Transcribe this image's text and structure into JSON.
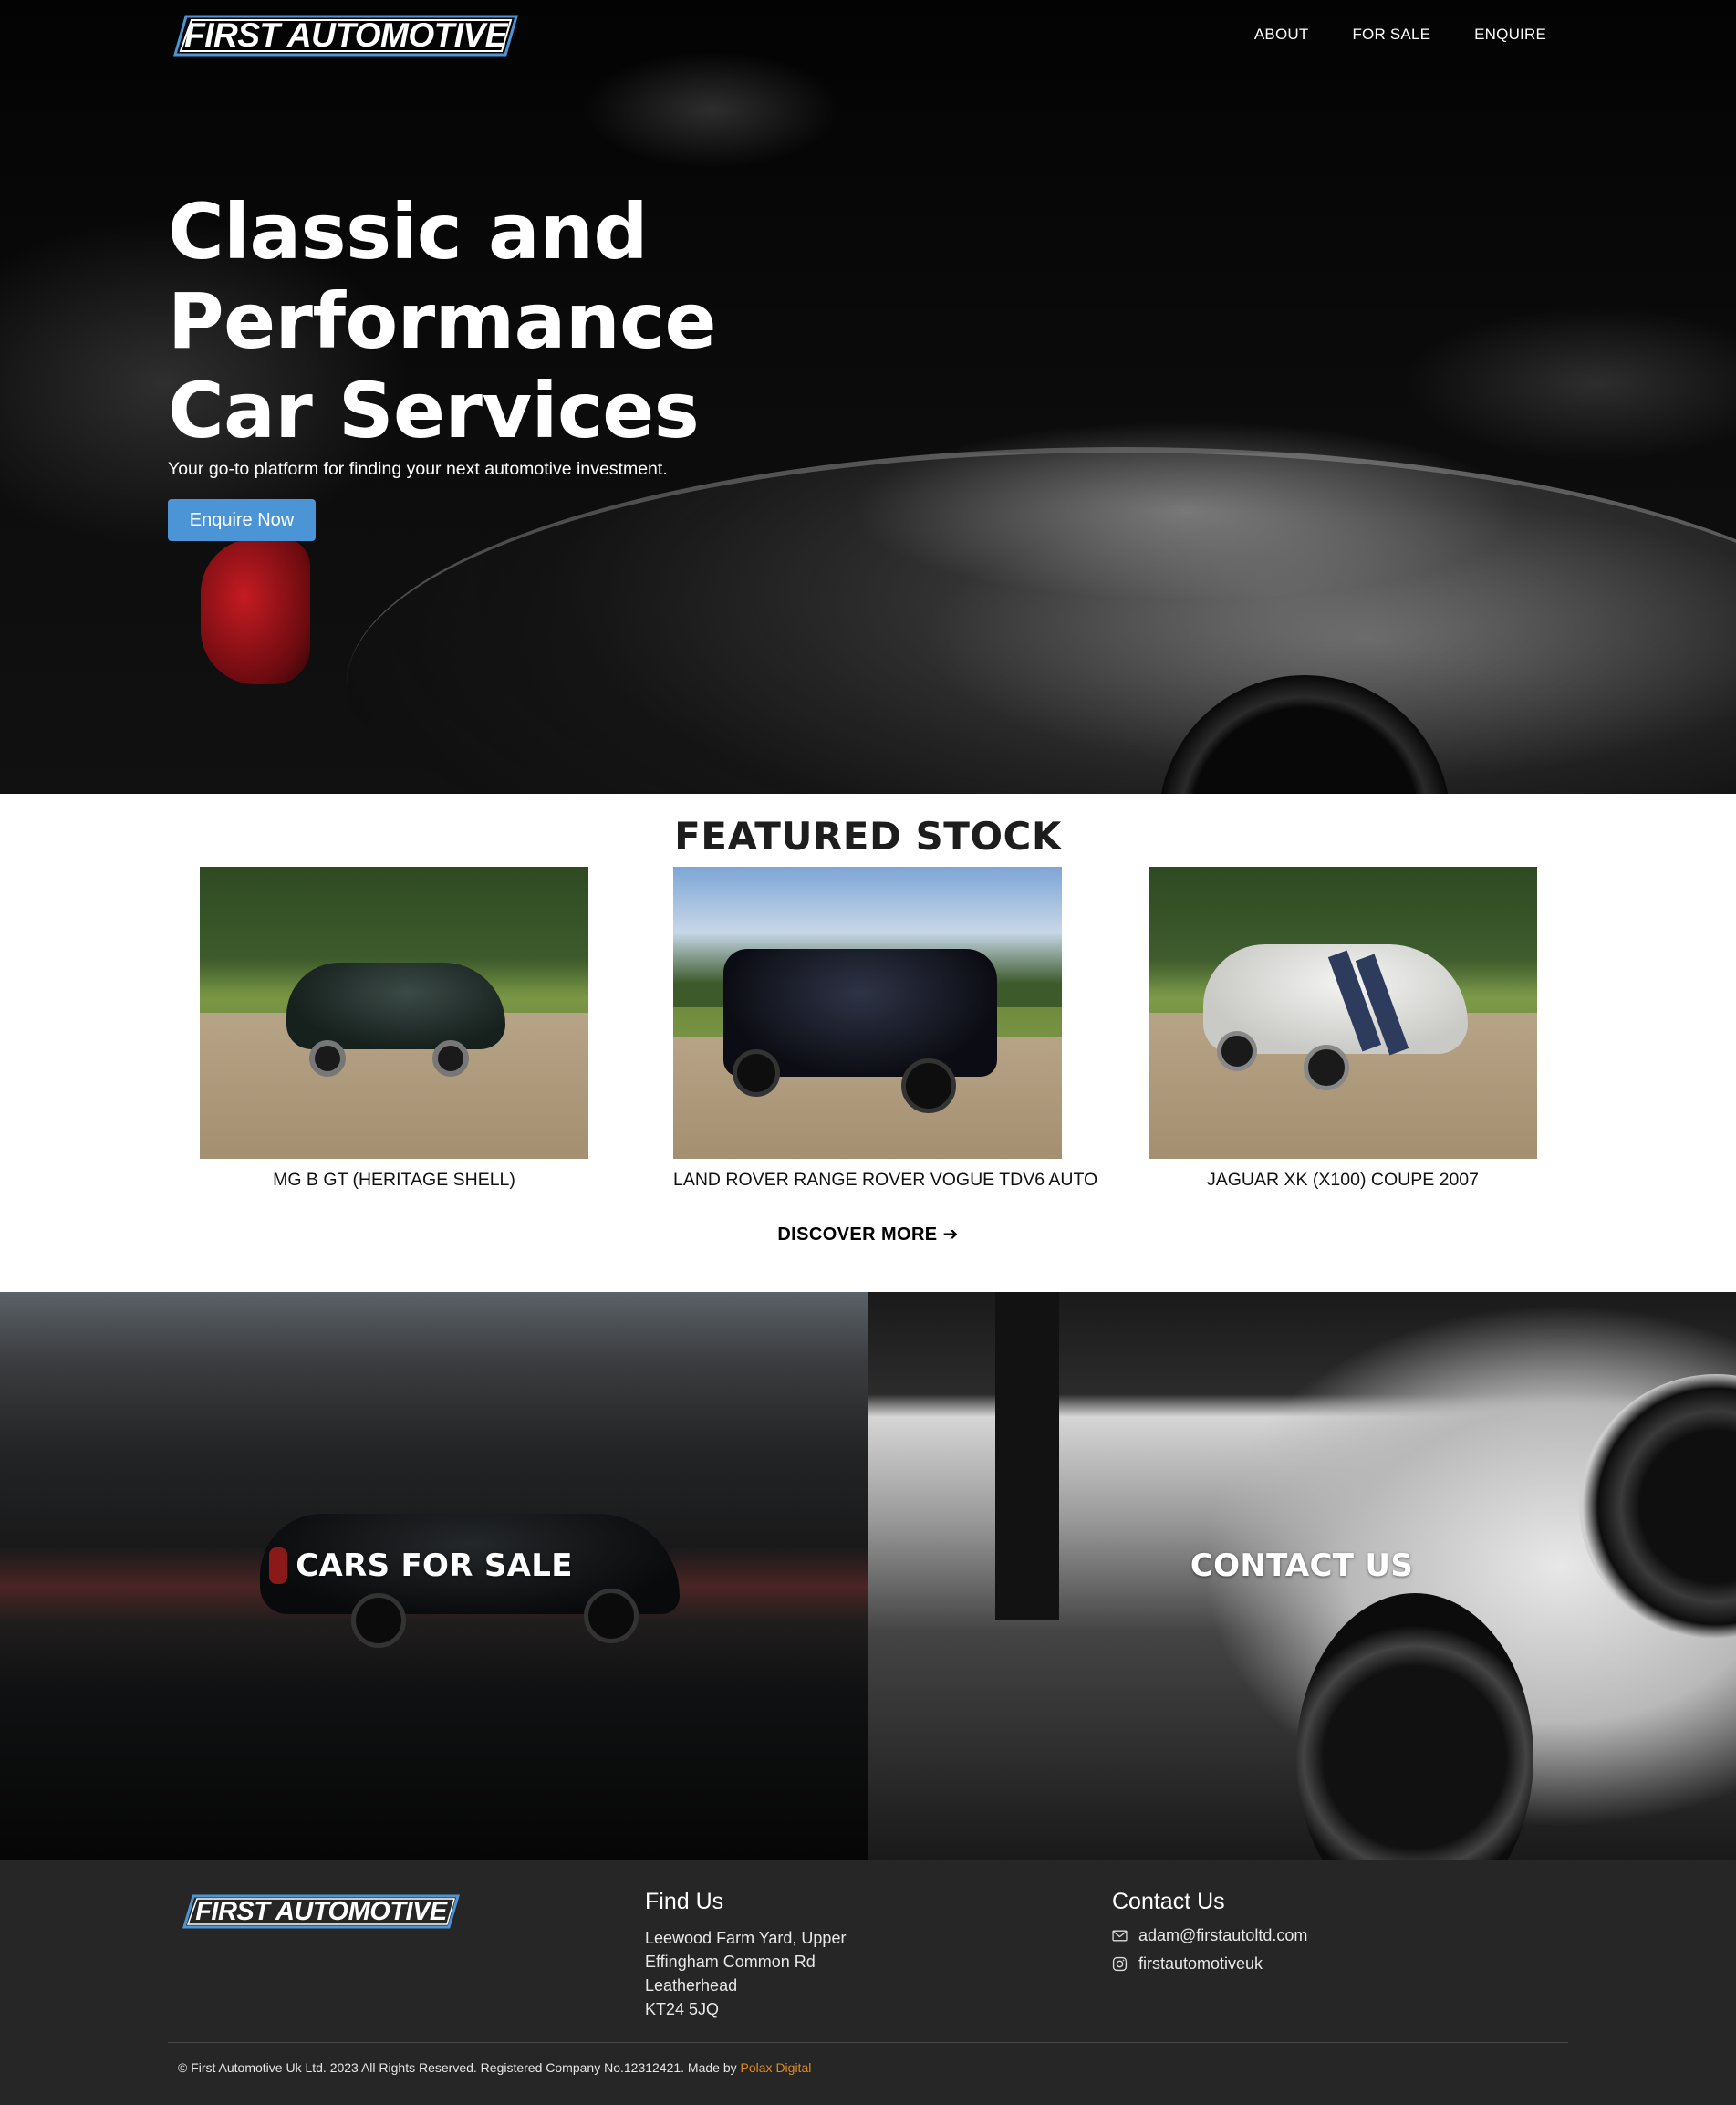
{
  "brand": {
    "name": "FIRST AUTOMOTIVE",
    "accent": "#4b95d6"
  },
  "nav": {
    "items": [
      "ABOUT",
      "FOR SALE",
      "ENQUIRE"
    ]
  },
  "hero": {
    "title": "Classic and Performance Car Services",
    "subtitle": "Your go-to platform for finding your next automotive investment.",
    "cta": "Enquire Now"
  },
  "featured": {
    "heading": "FEATURED STOCK",
    "cars": [
      {
        "title": "MG B GT (HERITAGE SHELL)"
      },
      {
        "title": "LAND ROVER RANGE ROVER VOGUE TDV6 AUTO"
      },
      {
        "title": "JAGUAR XK (X100) COUPE 2007"
      }
    ],
    "discover": "DISCOVER MORE ➔"
  },
  "tiles": {
    "for_sale": "CARS FOR SALE",
    "contact": "CONTACT US"
  },
  "footer": {
    "find_us": {
      "heading": "Find Us",
      "lines": [
        "Leewood Farm Yard, Upper",
        "Effingham Common Rd",
        "Leatherhead",
        "KT24 5JQ"
      ]
    },
    "contact": {
      "heading": "Contact Us",
      "email": "adam@firstautoltd.com",
      "instagram": "firstautomotiveuk"
    },
    "copyright": "© First Automotive Uk Ltd. 2023 All Rights Reserved. Registered Company No.12312421. Made by ",
    "maker": "Polax Digital",
    "maker_color": "#e08a1e"
  }
}
